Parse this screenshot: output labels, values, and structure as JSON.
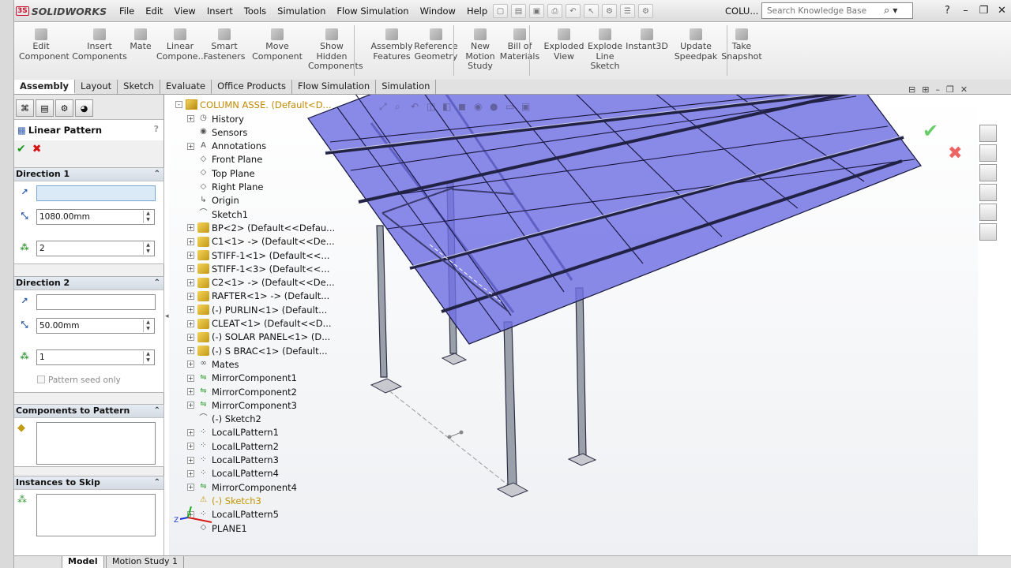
{
  "app": {
    "logo": "SOLIDWORKS",
    "document_title": "COLU..."
  },
  "menu": [
    "File",
    "Edit",
    "View",
    "Insert",
    "Tools",
    "Simulation",
    "Flow Simulation",
    "Window",
    "Help"
  ],
  "search": {
    "placeholder": "Search Knowledge Base"
  },
  "commands": [
    {
      "label": "Edit\nComponent"
    },
    {
      "label": "Insert\nComponents"
    },
    {
      "label": "Mate"
    },
    {
      "label": "Linear\nCompone..."
    },
    {
      "label": "Smart\nFasteners"
    },
    {
      "label": "Move\nComponent"
    },
    {
      "label": "Show\nHidden\nComponents"
    },
    {
      "label": "Assembly\nFeatures"
    },
    {
      "label": "Reference\nGeometry"
    },
    {
      "label": "New\nMotion\nStudy"
    },
    {
      "label": "Bill of\nMaterials"
    },
    {
      "label": "Exploded\nView"
    },
    {
      "label": "Explode\nLine\nSketch"
    },
    {
      "label": "Instant3D"
    },
    {
      "label": "Update\nSpeedpak"
    },
    {
      "label": "Take\nSnapshot"
    }
  ],
  "tabs": [
    "Assembly",
    "Layout",
    "Sketch",
    "Evaluate",
    "Office Products",
    "Flow Simulation",
    "Simulation"
  ],
  "property_manager": {
    "title": "Linear Pattern",
    "help": "?",
    "direction1": {
      "title": "Direction 1",
      "reference": "",
      "spacing": "1080.00mm",
      "instances": "2"
    },
    "direction2": {
      "title": "Direction 2",
      "reference": "",
      "spacing": "50.00mm",
      "instances": "1",
      "seed_only": "Pattern seed only"
    },
    "components_title": "Components to Pattern",
    "skip_title": "Instances to Skip"
  },
  "tree": [
    {
      "label": "COLUMN ASSE.  (Default<D...",
      "expander": "-",
      "icon": "asm"
    },
    {
      "label": "History",
      "expander": "+",
      "icon": "history"
    },
    {
      "label": "Sensors",
      "expander": "",
      "icon": "sensor"
    },
    {
      "label": "Annotations",
      "expander": "+",
      "icon": "A"
    },
    {
      "label": "Front Plane",
      "expander": "",
      "icon": "plane"
    },
    {
      "label": "Top Plane",
      "expander": "",
      "icon": "plane"
    },
    {
      "label": "Right Plane",
      "expander": "",
      "icon": "plane"
    },
    {
      "label": "Origin",
      "expander": "",
      "icon": "origin"
    },
    {
      "label": "Sketch1",
      "expander": "",
      "icon": "sketch"
    },
    {
      "label": "BP<2> (Default<<Defau...",
      "expander": "+",
      "icon": "part"
    },
    {
      "label": "C1<1> -> (Default<<De...",
      "expander": "+",
      "icon": "part"
    },
    {
      "label": "STIFF-1<1> (Default<<...",
      "expander": "+",
      "icon": "part"
    },
    {
      "label": "STIFF-1<3> (Default<<...",
      "expander": "+",
      "icon": "part"
    },
    {
      "label": "C2<1> -> (Default<<De...",
      "expander": "+",
      "icon": "part"
    },
    {
      "label": "RAFTER<1> -> (Default...",
      "expander": "+",
      "icon": "part"
    },
    {
      "label": "(-) PURLIN<1> (Default...",
      "expander": "+",
      "icon": "part"
    },
    {
      "label": "CLEAT<1> (Default<<D...",
      "expander": "+",
      "icon": "part"
    },
    {
      "label": "(-) SOLAR PANEL<1> (D...",
      "expander": "+",
      "icon": "part"
    },
    {
      "label": "(-) S BRAC<1> (Default...",
      "expander": "+",
      "icon": "part"
    },
    {
      "label": "Mates",
      "expander": "+",
      "icon": "mates"
    },
    {
      "label": "MirrorComponent1",
      "expander": "+",
      "icon": "mirror"
    },
    {
      "label": "MirrorComponent2",
      "expander": "+",
      "icon": "mirror"
    },
    {
      "label": "MirrorComponent3",
      "expander": "+",
      "icon": "mirror"
    },
    {
      "label": "(-) Sketch2",
      "expander": "",
      "icon": "sketch"
    },
    {
      "label": "LocalLPattern1",
      "expander": "+",
      "icon": "pattern"
    },
    {
      "label": "LocalLPattern2",
      "expander": "+",
      "icon": "pattern"
    },
    {
      "label": "LocalLPattern3",
      "expander": "+",
      "icon": "pattern"
    },
    {
      "label": "LocalLPattern4",
      "expander": "+",
      "icon": "pattern"
    },
    {
      "label": "MirrorComponent4",
      "expander": "+",
      "icon": "mirror"
    },
    {
      "label": "(-) Sketch3",
      "expander": "",
      "icon": "warning"
    },
    {
      "label": "LocalLPattern5",
      "expander": "+",
      "icon": "pattern"
    },
    {
      "label": "PLANE1",
      "expander": "",
      "icon": "plane"
    }
  ],
  "bottom_tabs": [
    "Model",
    "Motion Study 1"
  ]
}
